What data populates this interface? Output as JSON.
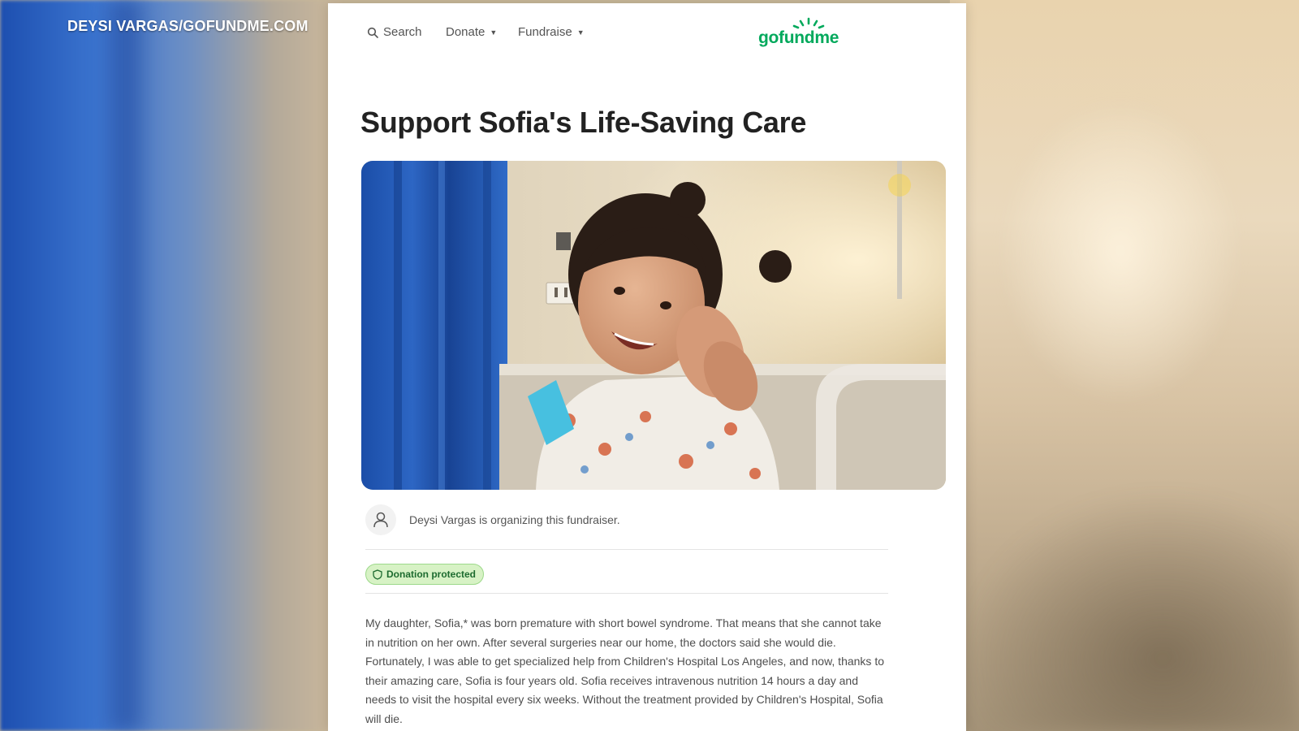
{
  "watermark": "DEYSI VARGAS/GOFUNDME.COM",
  "nav": {
    "search_label": "Search",
    "donate_label": "Donate",
    "fundraise_label": "Fundraise",
    "logo_text": "gofundme"
  },
  "campaign": {
    "title": "Support Sofia's Life-Saving Care",
    "organizer_text": "Deysi Vargas is organizing this fundraiser.",
    "badge_label": "Donation protected",
    "story": "My daughter, Sofia,* was born premature with short bowel syndrome. That means that she cannot take in nutrition on her own. After several surgeries near our home, the doctors said she would die. Fortunately, I was able to get specialized help from Children's Hospital Los Angeles, and now, thanks to their amazing care, Sofia is four years old. Sofia receives intravenous nutrition 14 hours a day and needs to visit the hospital every six weeks. Without the treatment provided by Children's Hospital, Sofia will die."
  },
  "icons": {
    "search": "search-icon",
    "caret": "chevron-down-icon",
    "user": "user-icon",
    "shield": "shield-icon"
  },
  "colors": {
    "brand_green": "#02a95c",
    "badge_bg": "#d7f2c5",
    "title_text": "#222222"
  }
}
